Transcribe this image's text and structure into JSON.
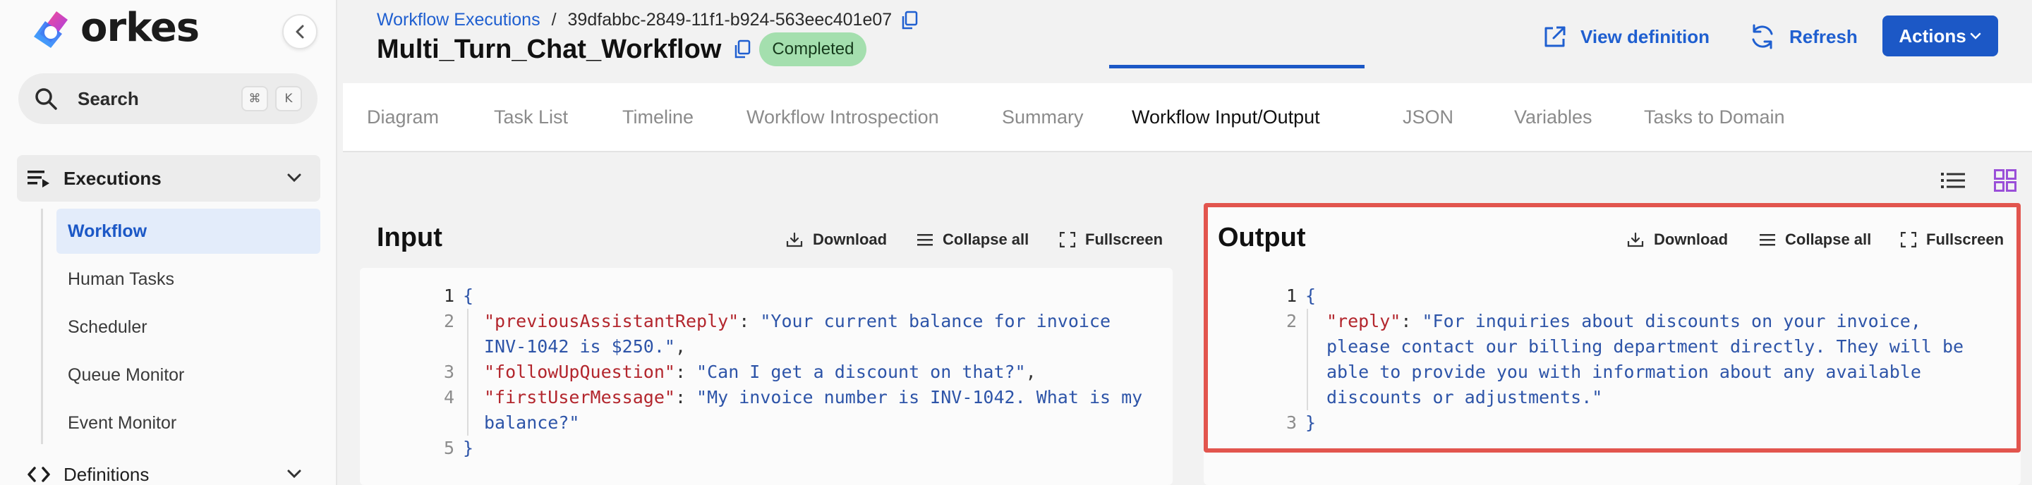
{
  "brand": {
    "name": "orkes"
  },
  "search": {
    "label": "Search",
    "key1": "⌘",
    "key2": "K"
  },
  "sidebar": {
    "executions_label": "Executions",
    "items": [
      {
        "label": "Workflow",
        "active": true
      },
      {
        "label": "Human Tasks"
      },
      {
        "label": "Scheduler"
      },
      {
        "label": "Queue Monitor"
      },
      {
        "label": "Event Monitor"
      }
    ],
    "definitions_label": "Definitions"
  },
  "breadcrumb": {
    "parent": "Workflow Executions",
    "separator": "/",
    "id": "39dfabbc-2849-11f1-b924-563eec401e07"
  },
  "header": {
    "title": "Multi_Turn_Chat_Workflow",
    "status": "Completed",
    "view_definition": "View definition",
    "refresh": "Refresh",
    "actions": "Actions"
  },
  "tabs": [
    {
      "label": "Diagram"
    },
    {
      "label": "Task List"
    },
    {
      "label": "Timeline"
    },
    {
      "label": "Workflow Introspection"
    },
    {
      "label": "Summary"
    },
    {
      "label": "Workflow Input/Output",
      "active": true
    },
    {
      "label": "JSON"
    },
    {
      "label": "Variables"
    },
    {
      "label": "Tasks to Domain"
    }
  ],
  "toolbar": {
    "download": "Download",
    "collapse_all": "Collapse all",
    "fullscreen": "Fullscreen"
  },
  "input_panel": {
    "title": "Input",
    "line_numbers": [
      "1",
      "2",
      "3",
      "4",
      "5"
    ],
    "brace_open": "{",
    "brace_close": "}",
    "entries": [
      {
        "key": "\"previousAssistantReply\"",
        "value_line1": "\"Your current balance for invoice",
        "value_line2": "INV-1042 is $250.\""
      },
      {
        "key": "\"followUpQuestion\"",
        "value_line1": "\"Can I get a discount on that?\""
      },
      {
        "key": "\"firstUserMessage\"",
        "value_line1": "\"My invoice number is INV-1042. What is my",
        "value_line2": "balance?\""
      }
    ]
  },
  "output_panel": {
    "title": "Output",
    "line_numbers": [
      "1",
      "2",
      "3"
    ],
    "brace_open": "{",
    "brace_close": "}",
    "entries": [
      {
        "key": "\"reply\"",
        "value_line1": "\"For inquiries about discounts on your invoice,",
        "value_line2": "please contact our billing department directly. They will be",
        "value_line3": "able to provide you with information about any available",
        "value_line4": "discounts or adjustments.\""
      }
    ]
  },
  "colors": {
    "accent": "#1c58c6",
    "status_badge_bg": "#a4dfae",
    "json_key": "#b3262d",
    "json_string": "#2d54a8",
    "highlight": "#e2554e"
  }
}
